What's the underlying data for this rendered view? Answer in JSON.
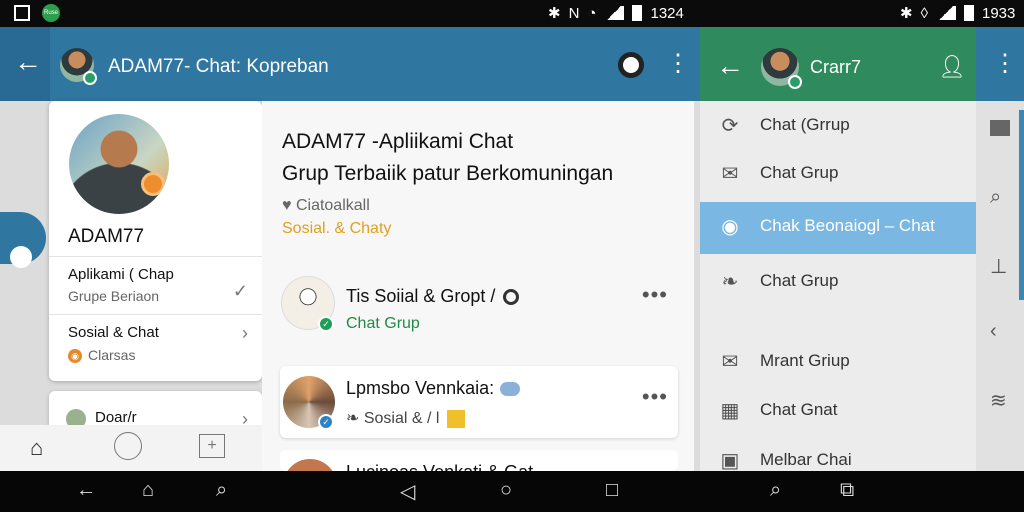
{
  "statusbar": {
    "left_icons": [
      "gallery-icon",
      "app-badge-icon"
    ],
    "app_badge_text": "Ruse",
    "mid_time": "1324",
    "right_time": "1933"
  },
  "left_header": {
    "back_icon": "arrow-left-icon",
    "title": "ADAM77- Chat: Kopreban",
    "action_icon": "compass-icon",
    "menu_icon": "kebab-icon"
  },
  "profile": {
    "name": "ADAM77",
    "row1_title": "Aplikami ( Chap",
    "row1_sub": "Grupe Beriaon",
    "row2_title": "Sosial & Chat",
    "row2_sub": "Clarsas",
    "next_label": "Doar/r"
  },
  "bottom_nav_left": [
    "home-icon",
    "location-icon",
    "add-icon"
  ],
  "main": {
    "title_line1": "ADAM77 -Apliikami Chat",
    "title_line2": "Grup Terbaiik patur Berkomuningan",
    "meta1": "Ciatoalkall",
    "meta2": "Sosial. & Chaty",
    "items": [
      {
        "title": "Tis Soiial & Gropt /",
        "subtitle": "Chat Grup",
        "subtitle_color": "#1f8c45"
      },
      {
        "title": "Lpmsbo Vennkaia:",
        "subtitle": "Sosial & / l"
      },
      {
        "title": "Lucinoas Venkati & Gat"
      }
    ],
    "more_label": "•••"
  },
  "right_header": {
    "back_icon": "arrow-left-icon",
    "title": "Crarr7",
    "profile_icon": "person-icon",
    "menu_icon": "kebab-icon"
  },
  "right_menu": [
    {
      "label": "Chat (Grrup",
      "icon": "refresh-icon",
      "active": false
    },
    {
      "label": "Chat Grup",
      "icon": "mail-icon",
      "active": false
    },
    {
      "label": "Chak Beonaiogl – Chat",
      "icon": "location-pin-icon",
      "active": true
    },
    {
      "label": "Chat Grup",
      "icon": "leaf-icon",
      "active": false
    },
    {
      "label": "Mrant Griup",
      "icon": "mail-icon",
      "active": false
    },
    {
      "label": "Chat Gnat",
      "icon": "building-icon",
      "active": false
    },
    {
      "label": "Melbar Chai",
      "icon": "book-icon",
      "active": false
    }
  ],
  "side_strip_icons": [
    "card-icon",
    "search-icon",
    "tack-icon",
    "chevron-left-icon",
    "stack-icon"
  ],
  "navbar_icons": [
    "back-icon",
    "home-icon",
    "search-icon",
    "back-triangle-icon",
    "home-circle-icon",
    "recents-icon",
    "search-icon",
    "tabs-icon"
  ],
  "colors": {
    "header_blue": "#2f76a0",
    "header_green": "#2f8a5d",
    "active_item": "#7ab8e3",
    "accent_gold": "#e0a020"
  }
}
